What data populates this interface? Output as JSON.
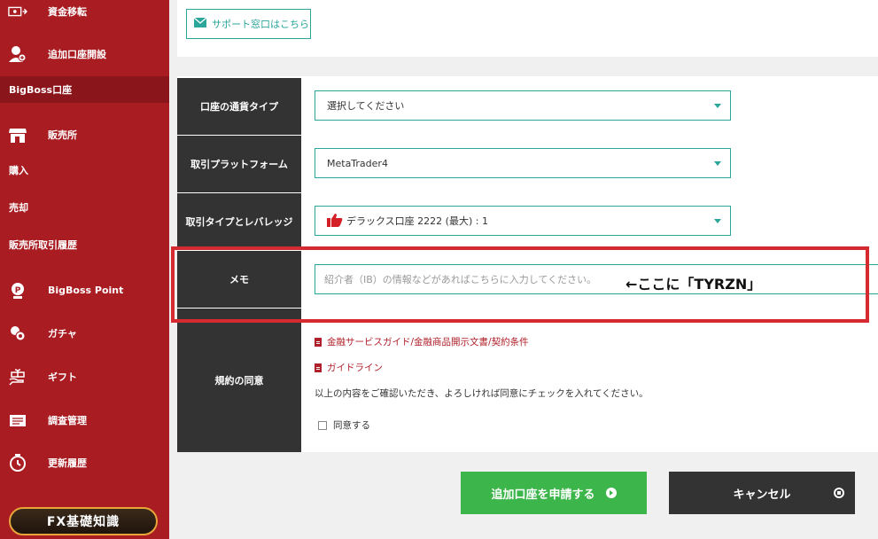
{
  "sidebar": {
    "items": [
      {
        "label": "資金移転",
        "icon": "money-transfer-icon"
      },
      {
        "label": "追加口座開設",
        "icon": "add-account-icon"
      },
      {
        "label": "BigBoss口座"
      },
      {
        "label": "販売所",
        "icon": "store-icon"
      },
      {
        "label": "購入"
      },
      {
        "label": "売却"
      },
      {
        "label": "販売所取引履歴"
      },
      {
        "label": "BigBoss Point",
        "icon": "point-icon"
      },
      {
        "label": "ガチャ",
        "icon": "gacha-icon"
      },
      {
        "label": "ギフト",
        "icon": "gift-icon"
      },
      {
        "label": "調査管理",
        "icon": "survey-icon"
      },
      {
        "label": "更新履歴",
        "icon": "history-icon"
      }
    ],
    "fx_button": "FX基礎知識"
  },
  "support": {
    "label": "サポート窓口はこちら"
  },
  "form": {
    "currency": {
      "label": "口座の通貨タイプ",
      "value": "選択してください"
    },
    "platform": {
      "label": "取引プラットフォーム",
      "value": "MetaTrader4"
    },
    "leverage": {
      "label": "取引タイプとレバレッジ",
      "value": "デラックス口座 2222 (最大) : 1"
    },
    "memo": {
      "label": "メモ",
      "placeholder": "紹介者（IB）の情報などがあればこちらに入力してください。"
    },
    "terms": {
      "label": "規約の同意",
      "links": [
        "金融サービスガイド/金融商品開示文書/契約条件",
        "ガイドライン"
      ],
      "notice": "以上の内容をご確認いただき、よろしければ同意にチェックを入れてください。",
      "checkbox_label": "同意する"
    }
  },
  "annotation": {
    "text": "←ここに「TYRZN」"
  },
  "buttons": {
    "submit": "追加口座を申請する",
    "cancel": "キャンセル"
  },
  "colors": {
    "sidebar": "#a81c22",
    "accent": "#2aa69a",
    "submit": "#3cb54a",
    "annotation": "#d52a30"
  }
}
